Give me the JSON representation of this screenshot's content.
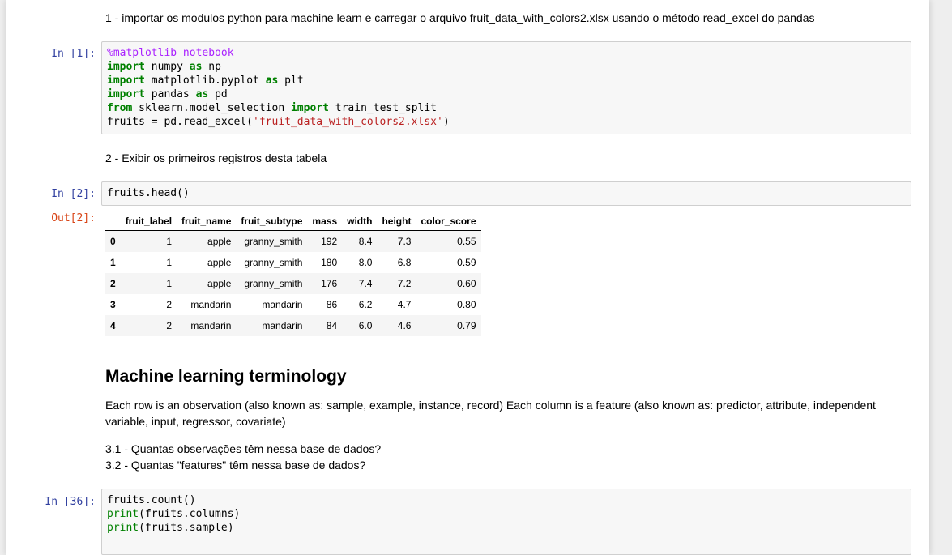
{
  "cells": {
    "md1": "1 - importar os modulos python para machine learn e carregar o arquivo fruit_data_with_colors2.xlsx usando o método read_excel do pandas",
    "in1_prompt": "In [1]:",
    "in1_code": {
      "l1": "%matplotlib notebook",
      "l2_kw": "import",
      "l2_a": " numpy ",
      "l2_as": "as",
      "l2_b": " np",
      "l3_kw": "import",
      "l3_a": " matplotlib.pyplot ",
      "l3_as": "as",
      "l3_b": " plt",
      "l4_kw": "import",
      "l4_a": " pandas ",
      "l4_as": "as",
      "l4_b": " pd",
      "l5_kw": "from",
      "l5_a": " sklearn.model_selection ",
      "l5_imp": "import",
      "l5_b": " train_test_split",
      "l6_a": "fruits = pd.read_excel(",
      "l6_str": "'fruit_data_with_colors2.xlsx'",
      "l6_b": ")"
    },
    "md2": "2 - Exibir os primeiros registros desta tabela",
    "in2_prompt": "In [2]:",
    "in2_code": "fruits.head()",
    "out2_prompt": "Out[2]:",
    "table": {
      "columns": [
        "",
        "fruit_label",
        "fruit_name",
        "fruit_subtype",
        "mass",
        "width",
        "height",
        "color_score"
      ],
      "rows": [
        [
          "0",
          "1",
          "apple",
          "granny_smith",
          "192",
          "8.4",
          "7.3",
          "0.55"
        ],
        [
          "1",
          "1",
          "apple",
          "granny_smith",
          "180",
          "8.0",
          "6.8",
          "0.59"
        ],
        [
          "2",
          "1",
          "apple",
          "granny_smith",
          "176",
          "7.4",
          "7.2",
          "0.60"
        ],
        [
          "3",
          "2",
          "mandarin",
          "mandarin",
          "86",
          "6.2",
          "4.7",
          "0.80"
        ],
        [
          "4",
          "2",
          "mandarin",
          "mandarin",
          "84",
          "6.0",
          "4.6",
          "0.79"
        ]
      ]
    },
    "heading": "Machine learning terminology",
    "md3": "Each row is an observation (also known as: sample, example, instance, record) Each column is a feature (also known as: predictor, attribute, independent variable, input, regressor, covariate)",
    "md4_l1": "3.1 - Quantas observações têm nessa base de dados?",
    "md4_l2": "3.2 - Quantas \"features\" têm nessa base de dados?",
    "in36_prompt": "In [36]:",
    "in36_code": {
      "l1": "fruits.count()",
      "l2_bi": "print",
      "l2_a": "(fruits.columns)",
      "l3_bi": "print",
      "l3_a": "(fruits.sample)"
    }
  }
}
